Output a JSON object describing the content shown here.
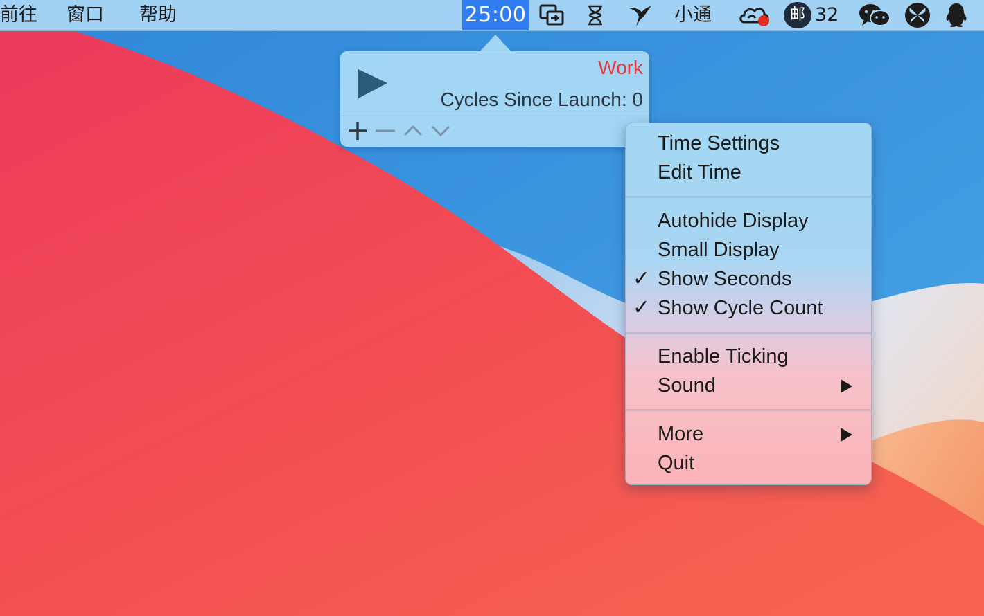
{
  "menubar": {
    "items": [
      "前往",
      "窗口",
      "帮助"
    ],
    "timer": "25:00",
    "status_icons": [
      "screen-share-icon",
      "hourglass-icon",
      "bird-icon",
      "cloud-sync-icon",
      "mail-icon",
      "wechat-icon",
      "butterfly-icon",
      "qq-penguin-icon"
    ],
    "xiaotong_label": "小通",
    "mail_badge_glyph": "邮",
    "mail_count": "32"
  },
  "popover": {
    "mode": "Work",
    "cycles": "Cycles Since Launch: 0",
    "mode_color": "#e8383a",
    "controls": [
      "plus-icon",
      "minus-icon",
      "chevron-up-icon",
      "chevron-down-icon"
    ]
  },
  "context_menu": {
    "group1": [
      "Time Settings",
      "Edit Time"
    ],
    "group2": [
      "Autohide Display",
      "Small Display",
      "Show Seconds",
      "Show Cycle Count"
    ],
    "group2_checked": [
      false,
      false,
      true,
      true
    ],
    "group3": [
      "Enable Ticking",
      "Sound"
    ],
    "group4": [
      "More",
      "Quit"
    ],
    "check_glyph": "✓"
  },
  "colors": {
    "timer_highlight": "#2f7df0",
    "wallpaper_red": "#f04a55",
    "wallpaper_blue": "#3f96de"
  }
}
